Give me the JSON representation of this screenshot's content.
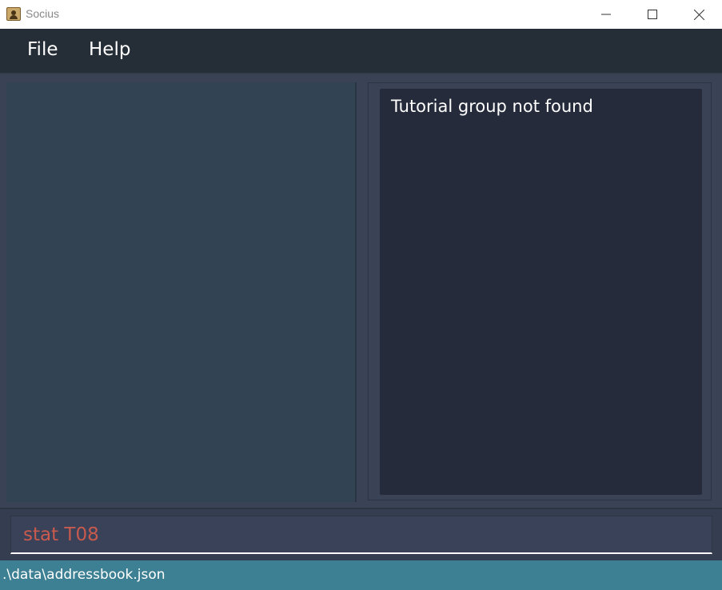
{
  "window": {
    "title": "Socius",
    "app_icon": "address-book-icon",
    "controls": {
      "minimize_icon": "minimize-icon",
      "maximize_icon": "maximize-icon",
      "close_icon": "close-icon"
    }
  },
  "menu": {
    "items": [
      {
        "label": "File"
      },
      {
        "label": "Help"
      }
    ]
  },
  "result": {
    "message": "Tutorial group not found"
  },
  "command": {
    "value": "stat T08",
    "text_color": "#c85a4e"
  },
  "status": {
    "file_path": ".\\data\\addressbook.json"
  },
  "colors": {
    "menubar": "#252d36",
    "left_pane": "#324354",
    "result_box": "#252b3a",
    "statusbar": "#3e8093"
  }
}
